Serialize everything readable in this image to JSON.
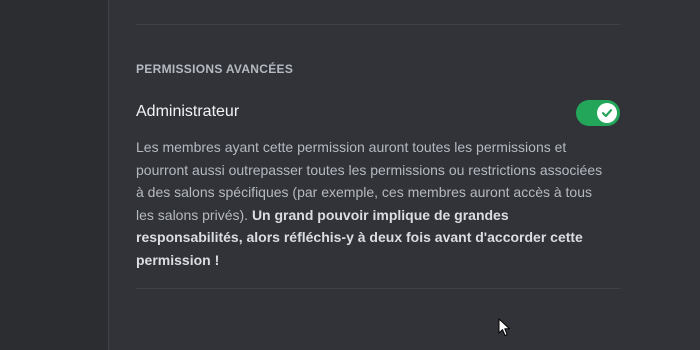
{
  "section": {
    "header": "PERMISSIONS AVANCÉES"
  },
  "permission": {
    "title": "Administrateur",
    "enabled": true,
    "toggle_color": "#23a55a",
    "description_plain": "Les membres ayant cette permission auront toutes les permissions et pourront aussi outrepasser toutes les permissions ou restrictions associées à des salons spécifiques (par exemple, ces membres auront accès à tous les salons privés).",
    "description_bold": "Un grand pouvoir implique de grandes responsabilités, alors réfléchis-y à deux fois avant d'accorder cette permission !"
  },
  "icons": {
    "toggle_check": "check-icon",
    "pointer": "mouse-cursor-icon"
  }
}
